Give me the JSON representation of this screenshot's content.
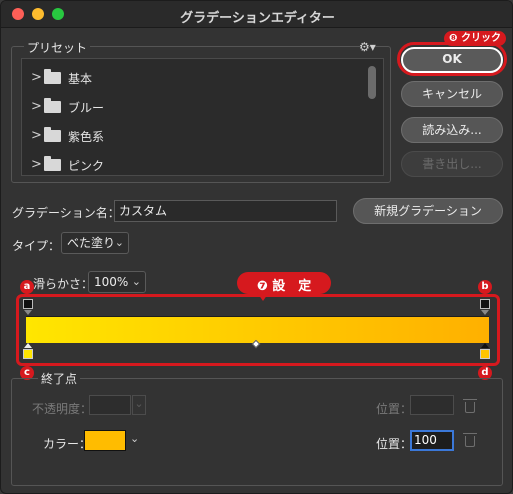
{
  "window": {
    "title": "グラデーションエディター",
    "traffic_colors": [
      "#fe5f57",
      "#febc2e",
      "#28c840"
    ]
  },
  "presets": {
    "label": "プリセット",
    "items": [
      {
        "label": "基本"
      },
      {
        "label": "ブルー"
      },
      {
        "label": "紫色系"
      },
      {
        "label": "ピンク"
      }
    ]
  },
  "buttons": {
    "ok": "OK",
    "cancel": "キャンセル",
    "import": "読み込み...",
    "export": "書き出し...",
    "new_gradient": "新規グラデーション"
  },
  "annotations": {
    "click_badge": "❽ クリック",
    "setting_badge": "❼ 設　定",
    "stop_a": "a",
    "stop_b": "b",
    "stop_c": "c",
    "stop_d": "d",
    "accent_color": "#d6191e"
  },
  "gradient": {
    "name_label": "グラデーション名：",
    "name_value": "カスタム",
    "type_label": "タイプ：",
    "type_value": "べた塗り",
    "smoothness_label": "滑らかさ：",
    "smoothness_value": "100%",
    "start_color": "#ffe600",
    "end_color": "#ffb000"
  },
  "stops": {
    "group_label": "終了点",
    "opacity_label": "不透明度：",
    "opacity_location_label": "位置：",
    "color_label": "カラー：",
    "color_location_label": "位置：",
    "location_value": "100",
    "color_value": "#ffbc00"
  }
}
